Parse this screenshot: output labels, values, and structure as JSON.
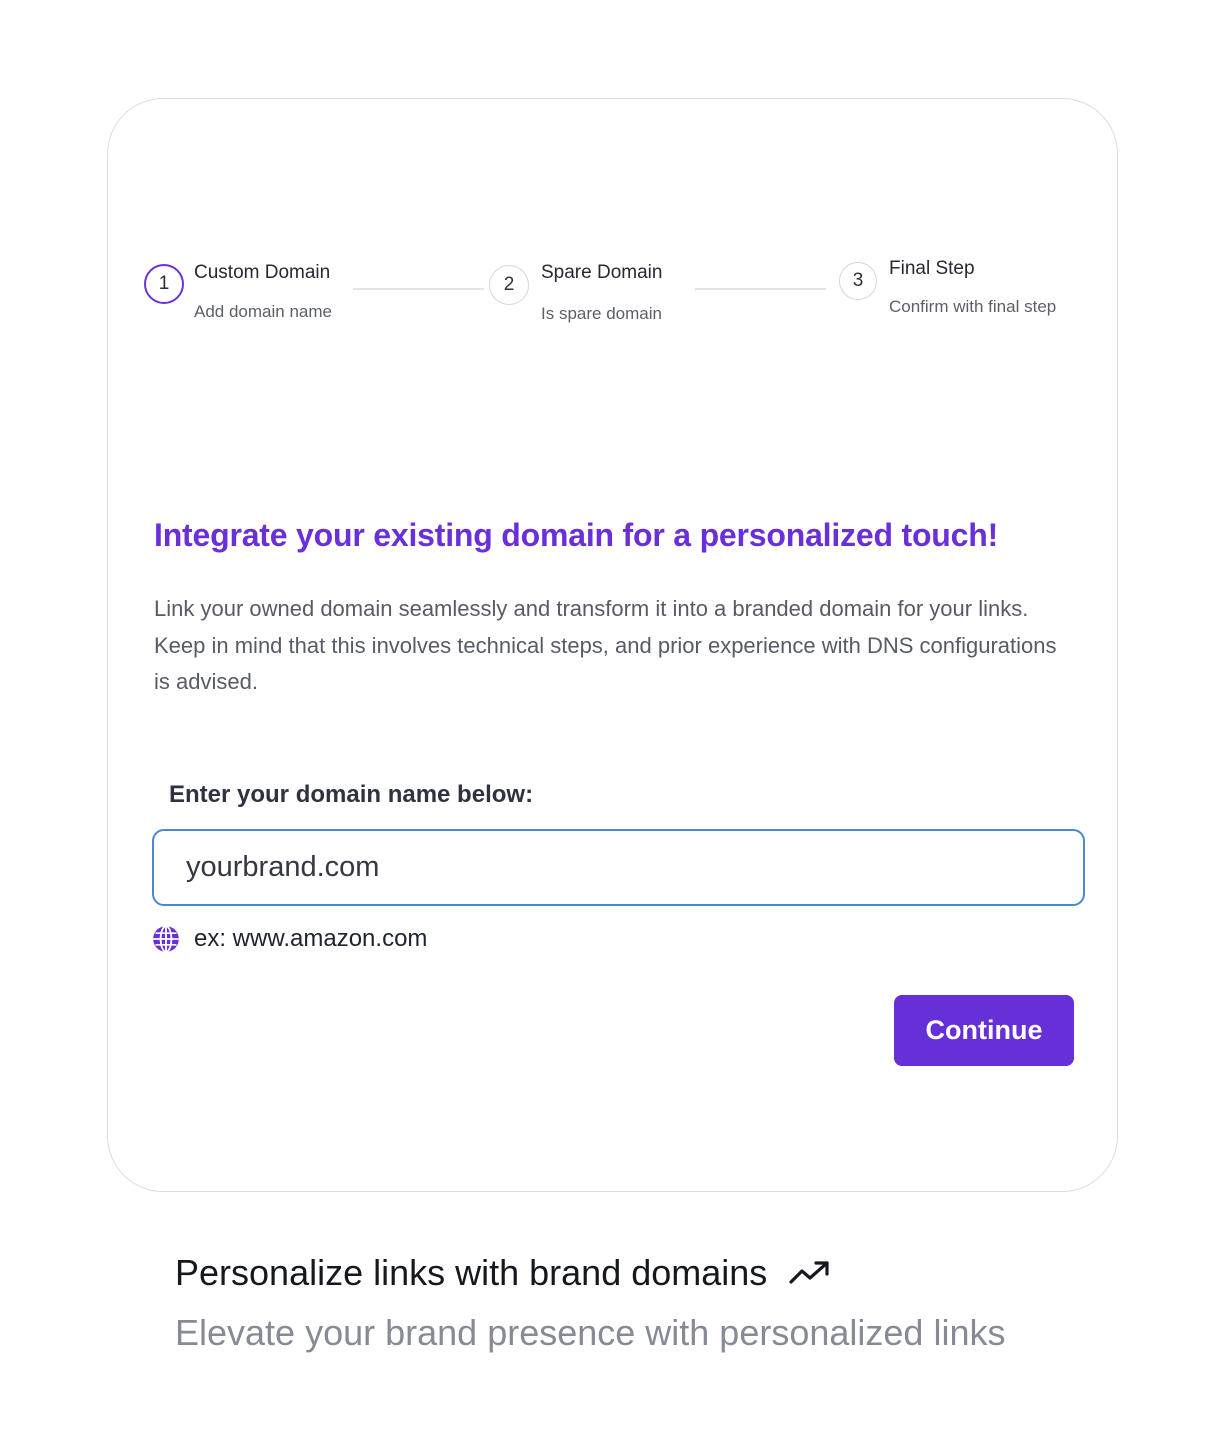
{
  "stepper": {
    "steps": [
      {
        "number": "1",
        "title": "Custom Domain",
        "subtitle": "Add domain name",
        "active": true
      },
      {
        "number": "2",
        "title": "Spare Domain",
        "subtitle": "Is spare domain",
        "active": false
      },
      {
        "number": "3",
        "title": "Final Step",
        "subtitle": "Confirm with final step",
        "active": false
      }
    ]
  },
  "main": {
    "headline": "Integrate your existing domain for a personalized touch!",
    "description": "Link your owned domain seamlessly and transform it into a branded domain for your links. Keep in mind that this involves technical steps, and prior experience with DNS configurations is advised.",
    "field_label": "Enter your domain name below:",
    "domain_value": "yourbrand.com",
    "hint_icon": "globe-icon",
    "hint_text": "ex: www.amazon.com",
    "continue_label": "Continue"
  },
  "footer": {
    "title": "Personalize links with brand domains",
    "title_icon": "trending-up-icon",
    "subtitle": "Elevate your brand presence with personalized links"
  },
  "colors": {
    "accent": "#6530d8",
    "headline": "#6a2fd9",
    "input_focus_border": "#4a88d4"
  }
}
